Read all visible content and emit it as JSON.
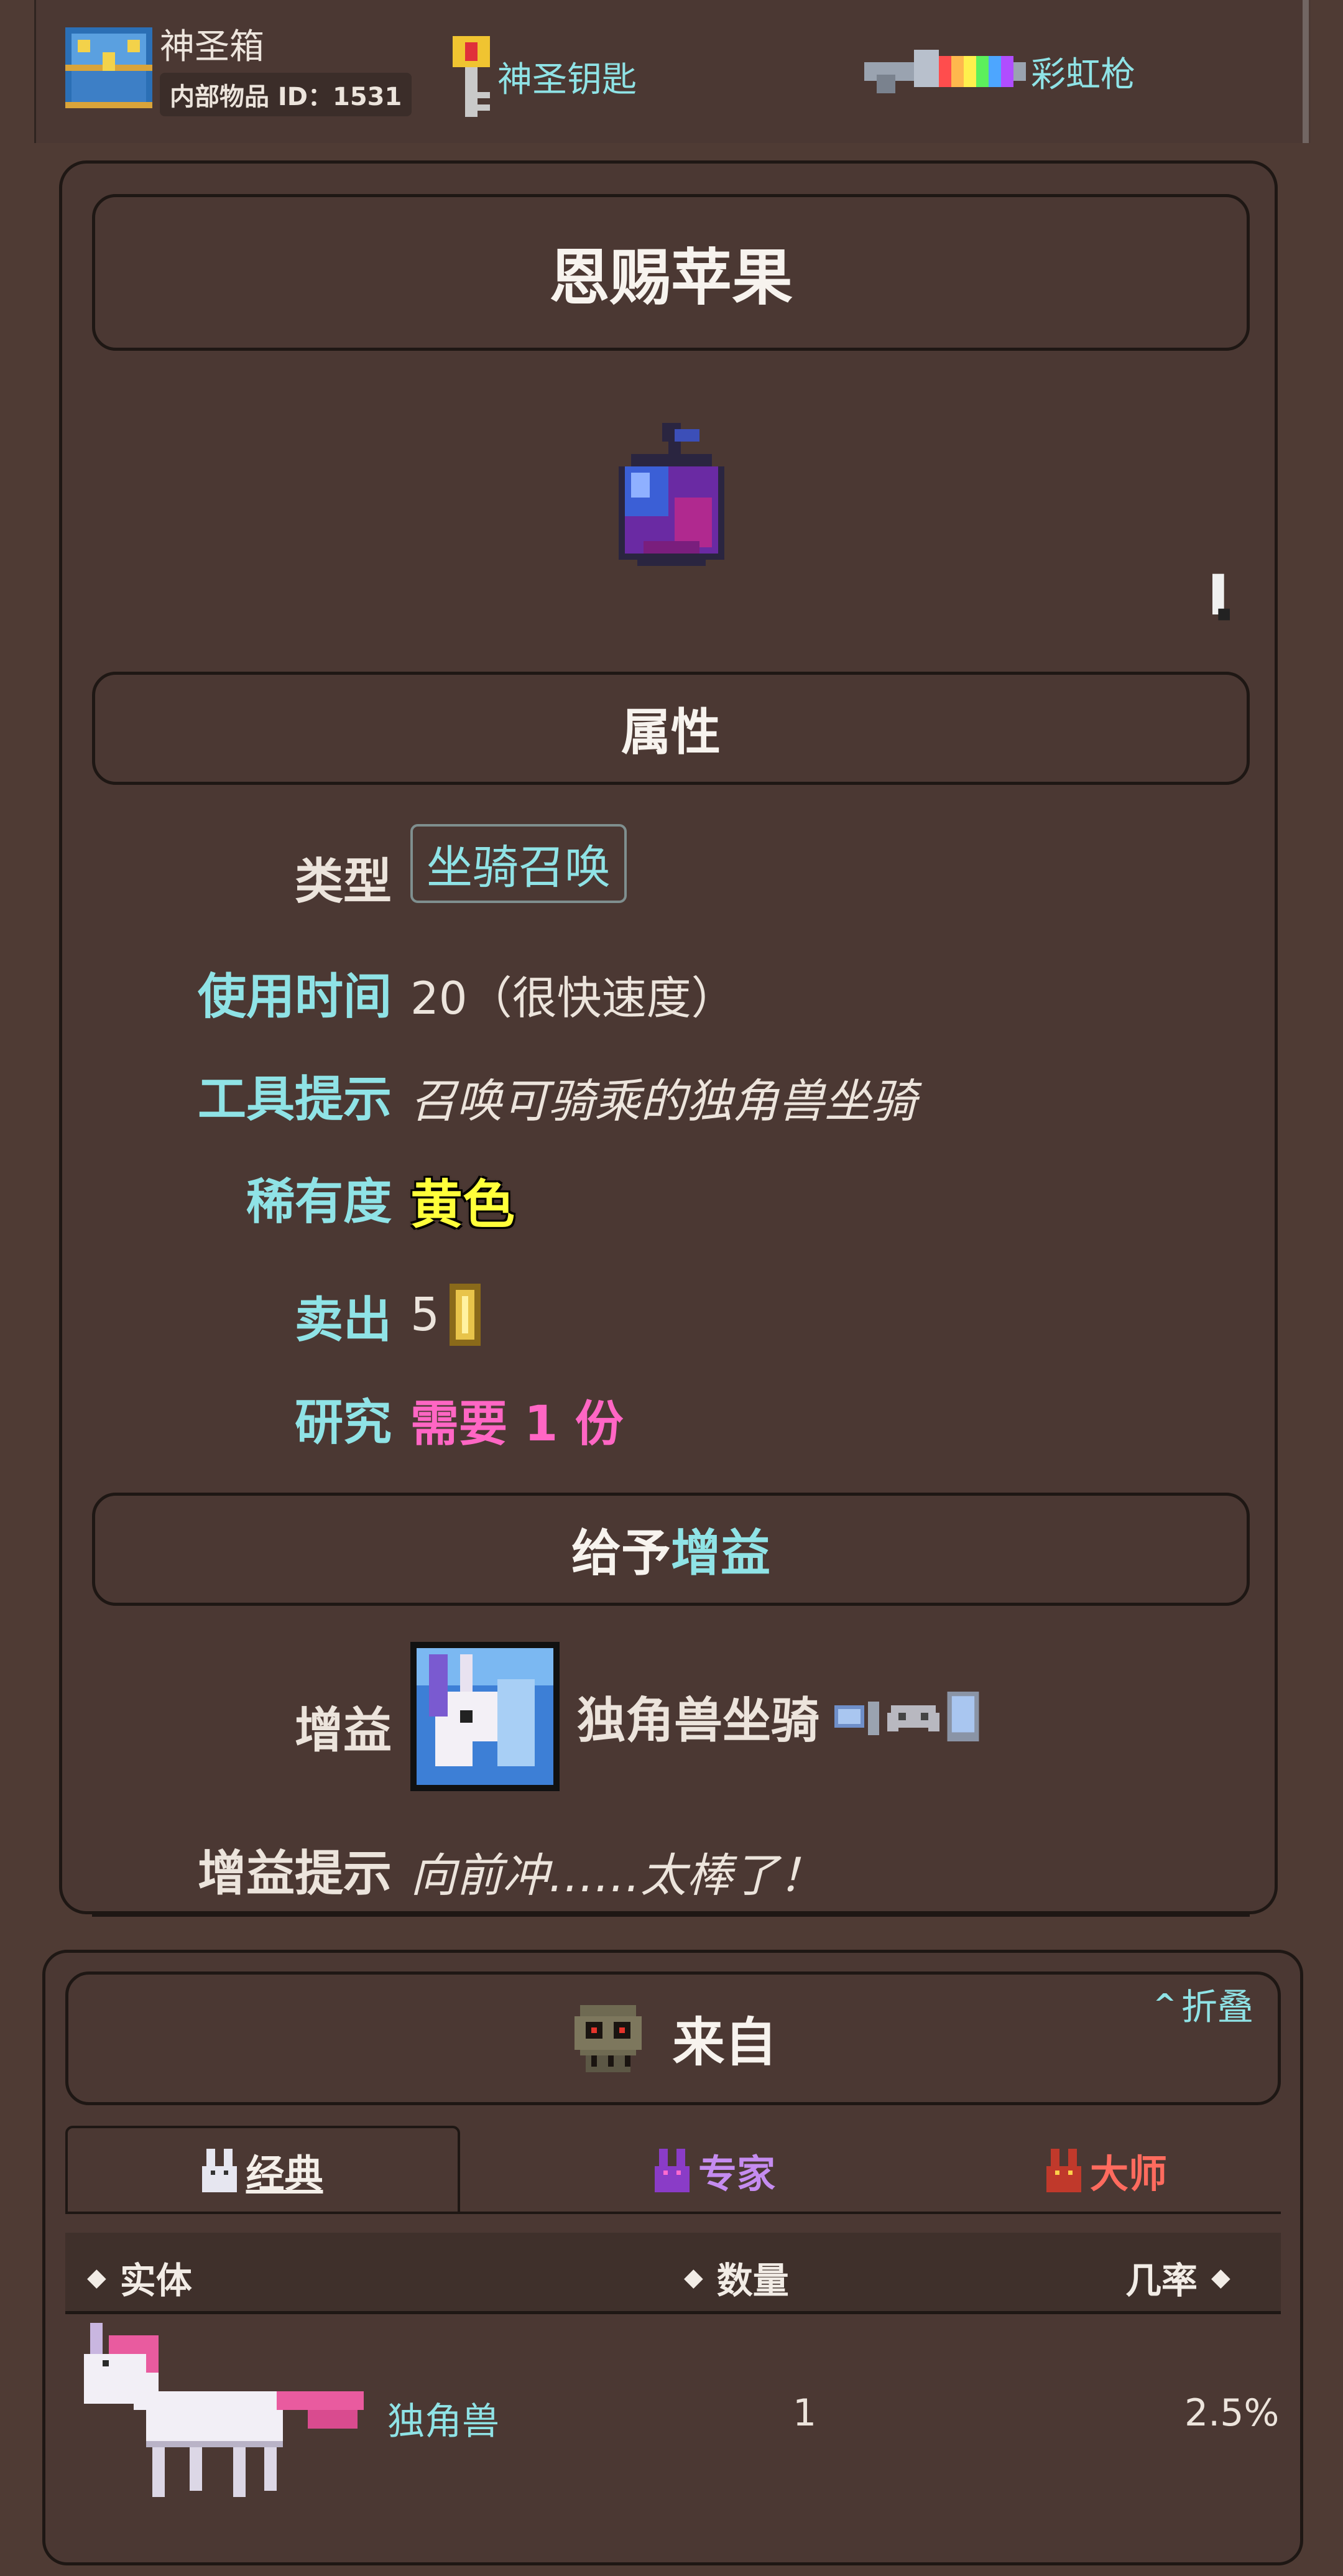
{
  "top_bar": {
    "chest": {
      "name": "神圣箱",
      "id_label": "内部物品 ID：",
      "id_value": "1531"
    },
    "key": {
      "name": "神圣钥匙"
    },
    "gun": {
      "name": "彩虹枪"
    }
  },
  "item": {
    "title": "恩赐苹果",
    "icon": "purple-apple-icon"
  },
  "attributes": {
    "section_title": "属性",
    "rows": [
      {
        "label": "类型",
        "value": "坐骑召唤"
      },
      {
        "label": "使用时间",
        "value": "20（很快速度）"
      },
      {
        "label": "工具提示",
        "value": "召唤可骑乘的独角兽坐骑"
      },
      {
        "label": "稀有度",
        "value": "黄色"
      },
      {
        "label": "卖出",
        "value": "5"
      },
      {
        "label": "研究",
        "value": "需要 1 份"
      }
    ]
  },
  "buff": {
    "section_title_prefix": "给予",
    "section_title_link": "增益",
    "label": "增益",
    "name": "独角兽坐骑",
    "tip_label": "增益提示",
    "tip_value": "向前冲……太棒了！"
  },
  "from": {
    "title": "来自",
    "collapse_label": "折叠",
    "tabs": [
      {
        "label": "经典",
        "color": "#f4efe9",
        "active": true
      },
      {
        "label": "专家",
        "color": "#c58cf0",
        "active": false
      },
      {
        "label": "大师",
        "color": "#ff6b5e",
        "active": false
      }
    ],
    "columns": {
      "entity": "实体",
      "quantity": "数量",
      "chance": "几率"
    },
    "rows": [
      {
        "entity": "独角兽",
        "quantity": "1",
        "chance": "2.5%"
      }
    ]
  },
  "colors": {
    "background": "#4f3b34",
    "panel": "#4b3833",
    "border": "#1e1714",
    "link_cyan": "#8fe3e6",
    "research_pink": "#ff66c4",
    "rarity_yellow": "#ffff3a"
  }
}
